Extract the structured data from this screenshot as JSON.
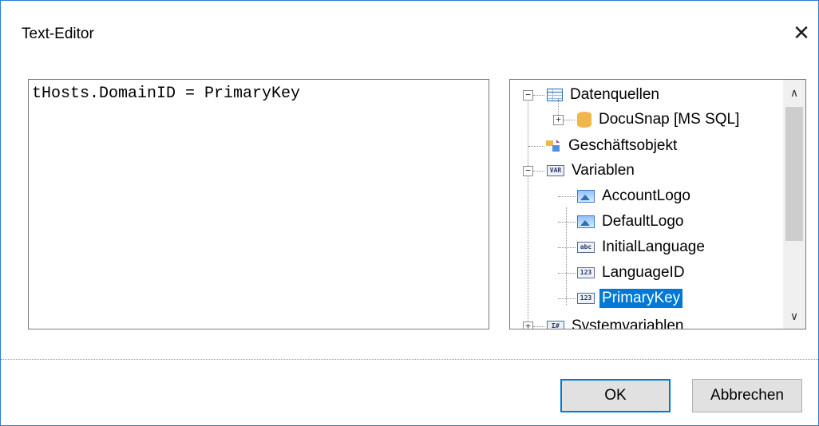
{
  "window": {
    "title": "Text-Editor",
    "close_symbol": "✕"
  },
  "editor": {
    "text": "tHosts.DomainID = PrimaryKey"
  },
  "tree": {
    "items": [
      {
        "label": "Datenquellen",
        "icon": "table-icon",
        "expander": "−"
      },
      {
        "label": "DocuSnap [MS SQL]",
        "icon": "database-icon",
        "expander": "+"
      },
      {
        "label": "Geschäftsobjekt",
        "icon": "business-object-icon"
      },
      {
        "label": "Variablen",
        "icon": "variable-icon",
        "expander": "−",
        "icon_text": "VAR"
      },
      {
        "label": "AccountLogo",
        "icon": "image-icon"
      },
      {
        "label": "DefaultLogo",
        "icon": "image-icon"
      },
      {
        "label": "InitialLanguage",
        "icon": "string-icon",
        "icon_text": "abc"
      },
      {
        "label": "LanguageID",
        "icon": "number-icon",
        "icon_text": "123"
      },
      {
        "label": "PrimaryKey",
        "icon": "number-icon",
        "icon_text": "123",
        "selected": true
      },
      {
        "label": "Systemvariablen",
        "icon": "system-variable-icon",
        "expander": "+",
        "icon_text": "Σ#"
      }
    ],
    "scroll_up": "∧",
    "scroll_down": "∨"
  },
  "buttons": {
    "ok": "OK",
    "cancel": "Abbrechen"
  },
  "colors": {
    "accent": "#0078d7",
    "window_border": "#2b7bd3",
    "selection": "#0078d7"
  }
}
